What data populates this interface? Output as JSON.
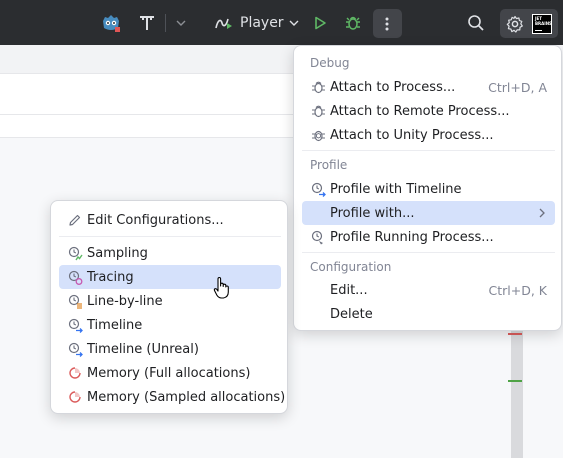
{
  "toolbar": {
    "run_config": "Player",
    "jetbrains_badge": "JET BRAINS"
  },
  "main_menu": {
    "debug_header": "Debug",
    "items": [
      {
        "label": "Attach to Process...",
        "shortcut": "Ctrl+D, A"
      },
      {
        "label": "Attach to Remote Process...",
        "shortcut": ""
      },
      {
        "label": "Attach to Unity Process...",
        "shortcut": ""
      }
    ],
    "profile_header": "Profile",
    "profile_items": [
      {
        "label": "Profile with Timeline"
      },
      {
        "label": "Profile with..."
      },
      {
        "label": "Profile Running Process..."
      }
    ],
    "config_header": "Configuration",
    "config_items": [
      {
        "label": "Edit...",
        "shortcut": "Ctrl+D, K"
      },
      {
        "label": "Delete",
        "shortcut": ""
      }
    ]
  },
  "sub_menu": {
    "edit_configurations": "Edit Configurations...",
    "items": [
      {
        "label": "Sampling"
      },
      {
        "label": "Tracing"
      },
      {
        "label": "Line-by-line"
      },
      {
        "label": "Timeline"
      },
      {
        "label": "Timeline (Unreal)"
      },
      {
        "label": "Memory (Full allocations)"
      },
      {
        "label": "Memory (Sampled allocations)"
      }
    ]
  },
  "colors": {
    "toolbar_bg": "#2b2d30",
    "menu_selection": "#d5e1fb",
    "run_green": "#5fb865",
    "marker_red": "#db5c5c",
    "marker_green": "#4fa346"
  }
}
